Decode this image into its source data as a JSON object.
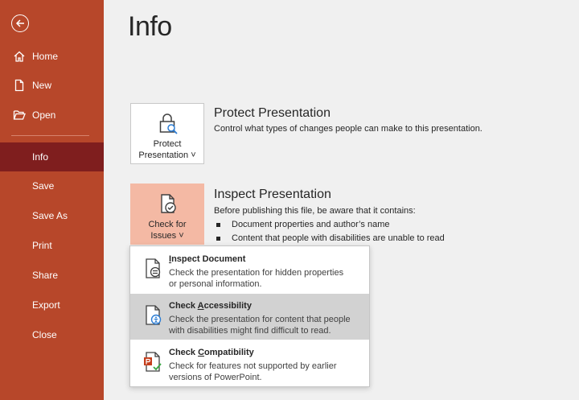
{
  "sidebar": {
    "items": [
      {
        "label": "Home",
        "icon": "home-icon"
      },
      {
        "label": "New",
        "icon": "new-file-icon"
      },
      {
        "label": "Open",
        "icon": "folder-open-icon"
      },
      {
        "label": "Info"
      },
      {
        "label": "Save"
      },
      {
        "label": "Save As"
      },
      {
        "label": "Print"
      },
      {
        "label": "Share"
      },
      {
        "label": "Export"
      },
      {
        "label": "Close"
      }
    ],
    "active": "Info"
  },
  "page": {
    "title": "Info"
  },
  "protect": {
    "tile_line1": "Protect",
    "tile_line2": "Presentation ˅",
    "title": "Protect Presentation",
    "description": "Control what types of changes people can make to this presentation."
  },
  "inspect": {
    "tile_line1": "Check for",
    "tile_line2": "Issues ˅",
    "title": "Inspect Presentation",
    "description": "Before publishing this file, be aware that it contains:",
    "bullets": [
      "Document properties and author’s name",
      "Content that people with disabilities are unable to read"
    ]
  },
  "dropdown": {
    "items": [
      {
        "title_pre": "",
        "title_key": "I",
        "title_post": "nspect Document",
        "desc_line1": "Check the presentation for hidden properties",
        "desc_line2": "or personal information."
      },
      {
        "title_pre": "Check ",
        "title_key": "A",
        "title_post": "ccessibility",
        "desc_line1": "Check the presentation for content that people",
        "desc_line2": "with disabilities might find difficult to read."
      },
      {
        "title_pre": "Check ",
        "title_key": "C",
        "title_post": "ompatibility",
        "desc_line1": "Check for features not supported by earlier",
        "desc_line2": "versions of PowerPoint."
      }
    ]
  },
  "colors": {
    "sidebar": "#b7472a",
    "active_nav": "#7f1e1e",
    "tile_highlight": "#f4b9a4",
    "hover_row": "#d2d2d2"
  }
}
